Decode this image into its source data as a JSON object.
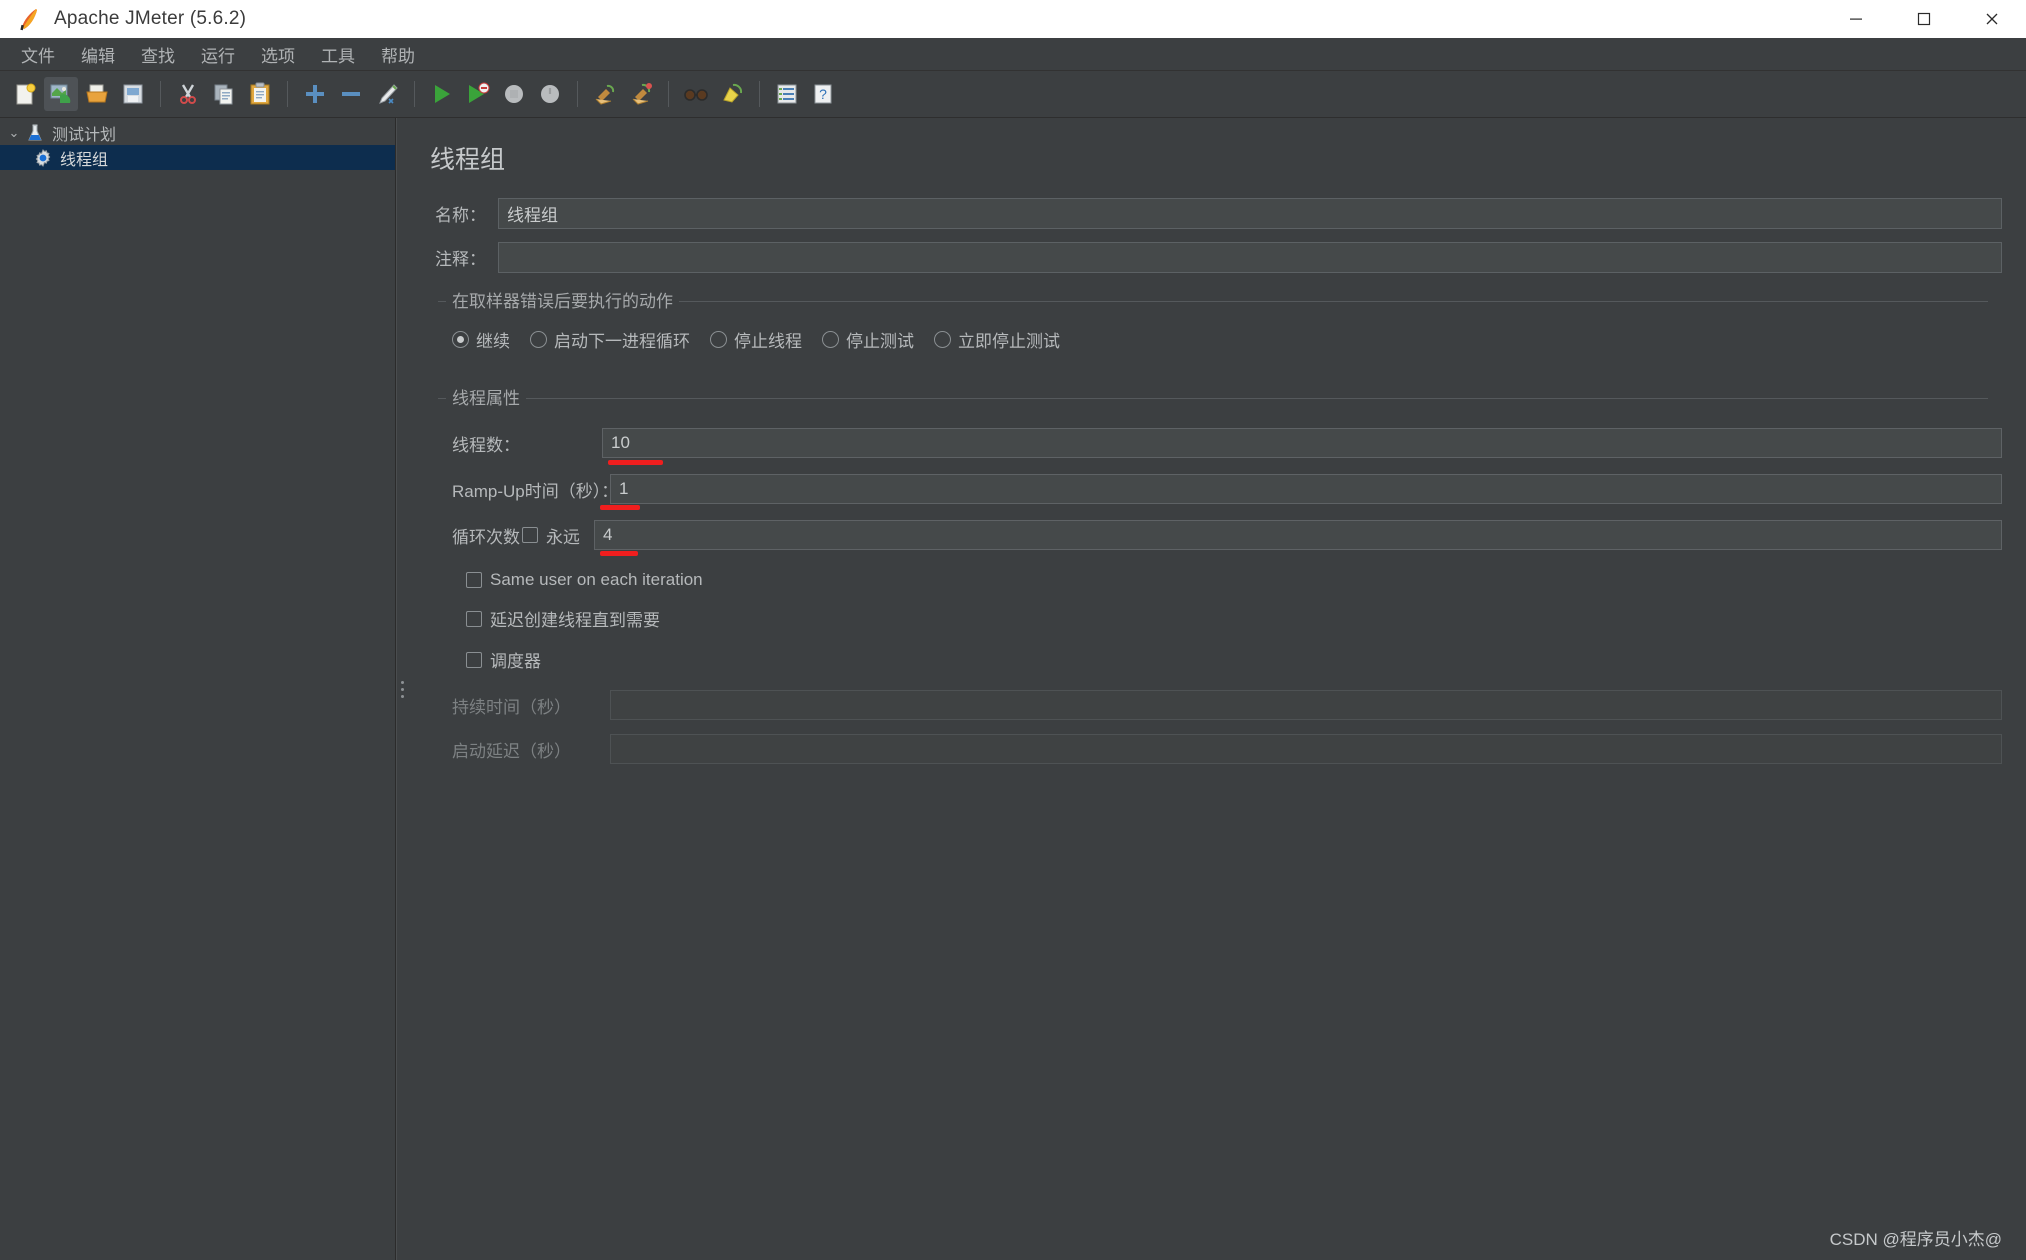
{
  "window": {
    "title": "Apache JMeter (5.6.2)",
    "app_icon": "jmeter-feather-icon",
    "minimize": "─",
    "maximize": "□",
    "close": "✕"
  },
  "menubar": {
    "items": [
      {
        "label": "文件",
        "name": "menu-file"
      },
      {
        "label": "编辑",
        "name": "menu-edit"
      },
      {
        "label": "查找",
        "name": "menu-search"
      },
      {
        "label": "运行",
        "name": "menu-run"
      },
      {
        "label": "选项",
        "name": "menu-options"
      },
      {
        "label": "工具",
        "name": "menu-tools"
      },
      {
        "label": "帮助",
        "name": "menu-help"
      }
    ]
  },
  "toolbar": {
    "buttons": [
      {
        "icon": "new-document-icon",
        "name": "new-test-plan-button",
        "active": false
      },
      {
        "icon": "templates-icon",
        "name": "templates-button",
        "active": true
      },
      {
        "icon": "open-folder-icon",
        "name": "open-button",
        "active": false
      },
      {
        "icon": "save-icon",
        "name": "save-button",
        "active": false
      },
      {
        "sep": true
      },
      {
        "icon": "cut-scissors-icon",
        "name": "cut-button",
        "active": false
      },
      {
        "icon": "copy-icon",
        "name": "copy-button",
        "active": false
      },
      {
        "icon": "paste-clipboard-icon",
        "name": "paste-button",
        "active": false
      },
      {
        "sep": true
      },
      {
        "icon": "plus-expand-icon",
        "name": "expand-all-button",
        "active": false
      },
      {
        "icon": "minus-collapse-icon",
        "name": "collapse-all-button",
        "active": false
      },
      {
        "icon": "toggle-pencil-icon",
        "name": "toggle-enable-button",
        "active": false
      },
      {
        "sep": true
      },
      {
        "icon": "start-play-icon",
        "name": "start-button",
        "active": false
      },
      {
        "icon": "start-no-pause-icon",
        "name": "start-no-pauses-button",
        "active": false
      },
      {
        "icon": "stop-icon",
        "name": "stop-button",
        "active": false
      },
      {
        "icon": "shutdown-icon",
        "name": "shutdown-button",
        "active": false
      },
      {
        "sep": true
      },
      {
        "icon": "clear-broom-icon",
        "name": "clear-button",
        "active": false
      },
      {
        "icon": "clear-all-broom-icon",
        "name": "clear-all-button",
        "active": false
      },
      {
        "sep": true
      },
      {
        "icon": "search-glasses-icon",
        "name": "search-button",
        "active": false
      },
      {
        "icon": "reset-search-icon",
        "name": "reset-search-button",
        "active": false
      },
      {
        "sep": true
      },
      {
        "icon": "function-helper-icon",
        "name": "function-helper-button",
        "active": false
      },
      {
        "icon": "help-question-icon",
        "name": "help-button",
        "active": false
      }
    ]
  },
  "tree": {
    "nodes": [
      {
        "label": "测试计划",
        "icon": "test-plan-flask-icon",
        "level": 0,
        "selected": false,
        "toggle": "⌄"
      },
      {
        "label": "线程组",
        "icon": "thread-group-gear-icon",
        "level": 1,
        "selected": true,
        "toggle": ""
      }
    ]
  },
  "panel": {
    "title": "线程组",
    "name": {
      "label": "名称：",
      "value": "线程组"
    },
    "comments": {
      "label": "注释：",
      "value": "",
      "placeholder": ""
    },
    "error_action": {
      "group_title": "在取样器错误后要执行的动作",
      "options": [
        {
          "label": "继续",
          "checked": true,
          "name": "radio-continue"
        },
        {
          "label": "启动下一进程循环",
          "checked": false,
          "name": "radio-start-next-loop"
        },
        {
          "label": "停止线程",
          "checked": false,
          "name": "radio-stop-thread"
        },
        {
          "label": "停止测试",
          "checked": false,
          "name": "radio-stop-test"
        },
        {
          "label": "立即停止测试",
          "checked": false,
          "name": "radio-stop-test-now"
        }
      ]
    },
    "thread_properties": {
      "group_title": "线程属性",
      "num_threads": {
        "label": "线程数：",
        "value": "10"
      },
      "ramp_up": {
        "label": "Ramp-Up时间（秒）：",
        "value": "1"
      },
      "loop_count": {
        "label": "循环次数",
        "forever_label": "永远",
        "forever_checked": false,
        "value": "4"
      },
      "same_user": {
        "label": "Same user on each iteration",
        "checked": false
      },
      "delayed_start": {
        "label": "延迟创建线程直到需要",
        "checked": false
      },
      "scheduler": {
        "label": "调度器",
        "checked": false
      },
      "duration": {
        "label": "持续时间（秒）",
        "value": "",
        "disabled": true
      },
      "startup_delay": {
        "label": "启动延迟（秒）",
        "value": "",
        "disabled": true
      }
    }
  },
  "watermark": "CSDN @程序员小杰@",
  "colors": {
    "background": "#3c3f41",
    "selection": "#0d2d4e",
    "annotation": "#f01e1e",
    "text": "#b6b9bb"
  }
}
